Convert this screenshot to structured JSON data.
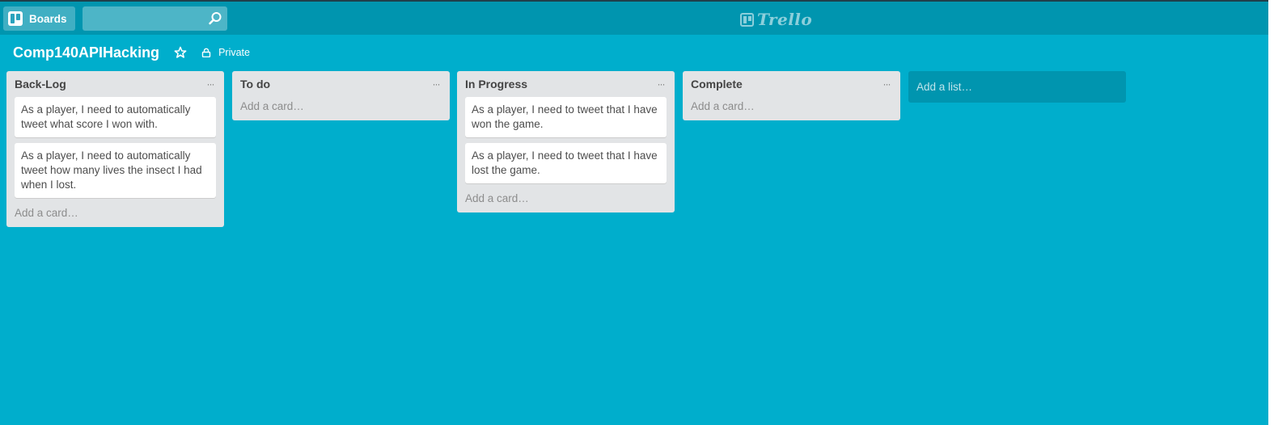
{
  "header": {
    "boards_label": "Boards",
    "search_placeholder": "",
    "logo_text": "Trello",
    "search_icon": "magnifier-icon",
    "boards_icon": "boards-icon"
  },
  "board": {
    "title": "Comp140APIHacking",
    "star_icon": "star-icon",
    "lock_icon": "lock-icon",
    "privacy": "Private"
  },
  "lists": [
    {
      "title": "Back-Log",
      "menu": "···",
      "cards": [
        "As a player, I need to automatically tweet what score I won with.",
        "As a player, I need to automatically tweet how many lives the insect I had when I lost."
      ],
      "add_card": "Add a card…"
    },
    {
      "title": "To do",
      "menu": "···",
      "cards": [],
      "add_card": "Add a card…"
    },
    {
      "title": "In Progress",
      "menu": "···",
      "cards": [
        "As a player, I need to tweet that I have won the game.",
        "As a player, I need to tweet that I have lost the game."
      ],
      "add_card": "Add a card…"
    },
    {
      "title": "Complete",
      "menu": "···",
      "cards": [],
      "add_card": "Add a card…"
    }
  ],
  "add_list_label": "Add a list…",
  "colors": {
    "background": "#00AECC",
    "topbar": "#0095AF",
    "list_bg": "#E2E4E6",
    "card_bg": "#FFFFFF"
  }
}
